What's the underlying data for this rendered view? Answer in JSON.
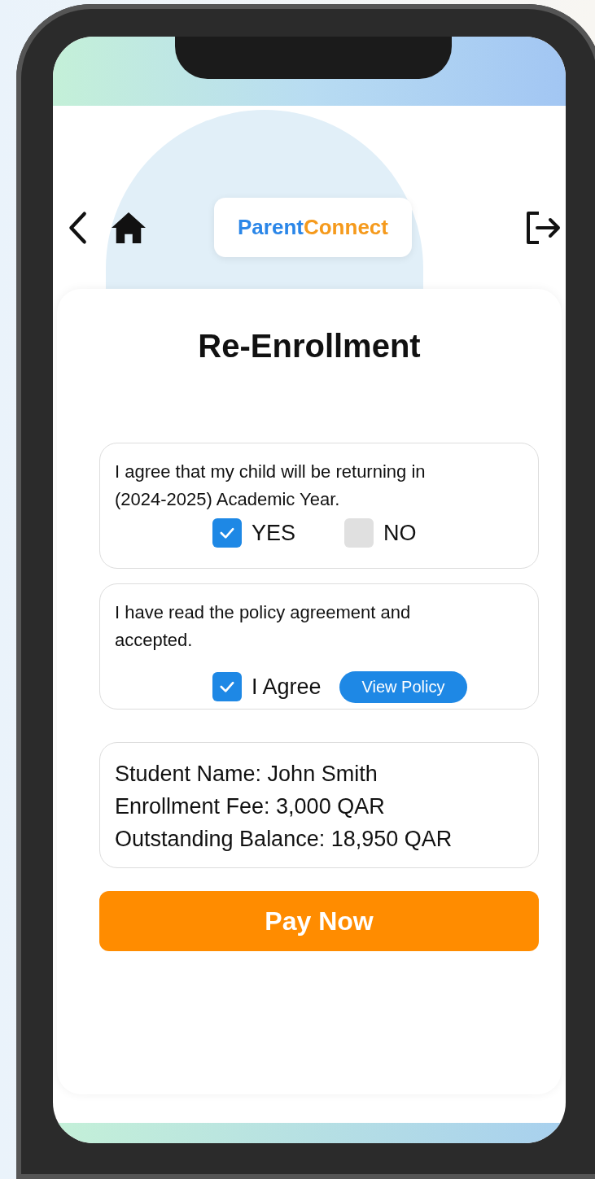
{
  "header": {
    "logo": {
      "part_1": "Parent",
      "part_2": "Connect"
    }
  },
  "title": "Re-Enrollment",
  "questions": [
    {
      "kind": "yesno",
      "text": "I agree that my child will be returning in (2024-2025) Academic Year.",
      "options": [
        {
          "label": "YES",
          "checked": true
        },
        {
          "label": "NO",
          "checked": false
        }
      ]
    },
    {
      "kind": "agree",
      "text": "I have read the policy agreement and accepted.",
      "options": [
        {
          "label": "I Agree",
          "checked": true
        }
      ],
      "link": "View Policy"
    }
  ],
  "details": [
    "Student Name: John Smith",
    "Enrollment Fee: 3,000 QAR",
    "Outstanding Balance: 18,950 QAR"
  ],
  "pay_button": "Pay Now"
}
